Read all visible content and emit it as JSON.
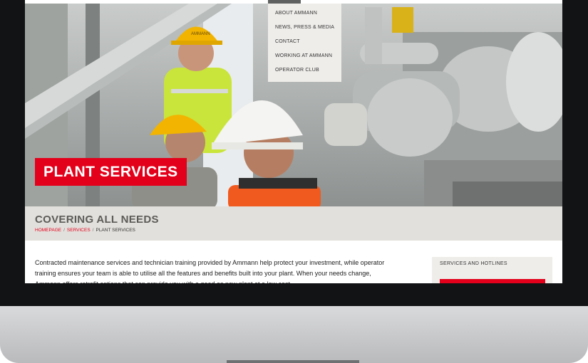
{
  "nav": {
    "dropdown": [
      {
        "label": "About Ammann"
      },
      {
        "label": "News, Press & Media"
      },
      {
        "label": "Contact"
      },
      {
        "label": "Working at Ammann"
      },
      {
        "label": "Operator Club"
      }
    ]
  },
  "hero": {
    "banner": "PLANT SERVICES",
    "hard_hat_text": "AMMANN"
  },
  "header": {
    "title": "COVERING ALL NEEDS",
    "breadcrumb": {
      "home": "HOMEPAGE",
      "services": "SERVICES",
      "current": "PLANT SERVICES"
    }
  },
  "content": {
    "intro": "Contracted maintenance services and technician training provided by Ammann help protect your investment, while operator training ensures your team is able to utilise all the features and benefits built into your plant. When your needs change, Ammann offers retrofit options that can provide you with a good as new plant at a low cost."
  },
  "sidebar": {
    "box_title": "SERVICES AND HOTLINES"
  },
  "colors": {
    "brand_red": "#e3001b",
    "band_grey": "#e2e0dc",
    "dropdown_bg": "#efedea"
  }
}
